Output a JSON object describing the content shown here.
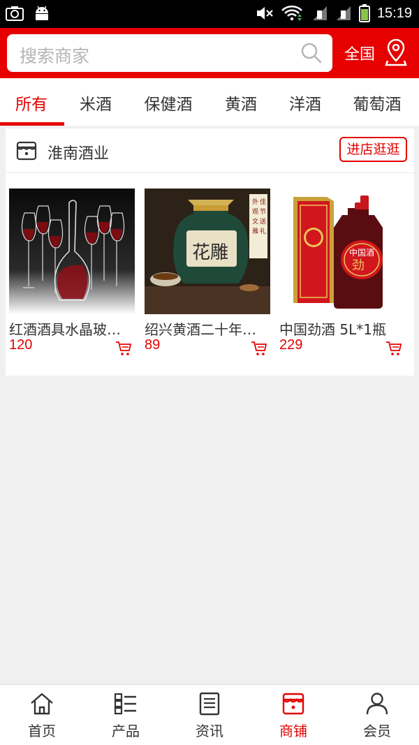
{
  "status_bar": {
    "time": "15:19"
  },
  "header": {
    "search_placeholder": "搜索商家",
    "region_label": "全国"
  },
  "tabs": [
    {
      "label": "所有",
      "active": true
    },
    {
      "label": "米酒"
    },
    {
      "label": "保健酒"
    },
    {
      "label": "黄酒"
    },
    {
      "label": "洋酒"
    },
    {
      "label": "葡萄酒"
    }
  ],
  "store": {
    "name": "淮南酒业",
    "visit_label": "进店逛逛",
    "products": [
      {
        "name": "红酒酒具水晶玻…",
        "price": "120"
      },
      {
        "name": "绍兴黄酒二十年…",
        "price": "89"
      },
      {
        "name": "中国劲酒 5L*1瓶",
        "price": "229"
      }
    ]
  },
  "bottom_nav": [
    {
      "label": "首页",
      "icon": "home-icon"
    },
    {
      "label": "产品",
      "icon": "list-icon"
    },
    {
      "label": "资讯",
      "icon": "news-icon"
    },
    {
      "label": "商铺",
      "icon": "shop-icon",
      "active": true
    },
    {
      "label": "会员",
      "icon": "user-icon"
    }
  ],
  "colors": {
    "accent": "#e60000",
    "background": "#f0f0f0"
  }
}
